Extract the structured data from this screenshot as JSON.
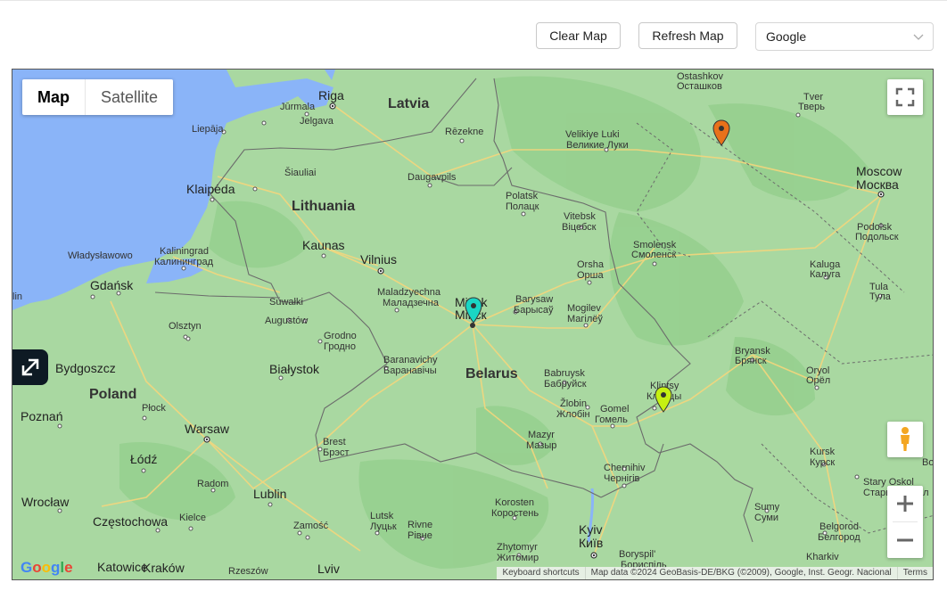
{
  "toolbar": {
    "clear_label": "Clear Map",
    "refresh_label": "Refresh Map",
    "provider_selected": "Google"
  },
  "map": {
    "type_controls": {
      "map_label": "Map",
      "satellite_label": "Satellite",
      "active": "Map"
    },
    "countries": [
      "Latvia",
      "Lithuania",
      "Belarus",
      "Poland"
    ],
    "labels": {
      "riga": "Riga",
      "jurmala": "Jūrmala",
      "jelgava": "Jelgava",
      "liepaja": "Liepāja",
      "rezekne": "Rēzekne",
      "siauliai": "Šiauliai",
      "daugavpils": "Daugavpils",
      "klaipeda": "Klaipėda",
      "kaunas": "Kaunas",
      "vilnius": "Vilnius",
      "kaliningrad": "Kaliningrad",
      "kaliningrad_ru": "Калининград",
      "wladyslawowo": "Władysławowo",
      "gdansk": "Gdańsk",
      "suwalki": "Suwałki",
      "augustow": "Augustów",
      "olsztyn": "Olsztyn",
      "bydgoszcz": "Bydgoszcz",
      "bialystok": "Białystok",
      "grodno": "Grodno",
      "grodno_ru": "Гродно",
      "poznan": "Poznań",
      "plock": "Płock",
      "warsaw": "Warsaw",
      "lodz": "Łódź",
      "radom": "Radom",
      "lublin": "Lublin",
      "wroclaw": "Wrocław",
      "czestochowa": "Częstochowa",
      "kielce": "Kielce",
      "katowice": "Katowice",
      "krakow": "Kraków",
      "rzeszow": "Rzeszów",
      "lviv": "Lviv",
      "zamosc": "Zamość",
      "maladzyechna": "Maladzyechna",
      "maladzyechna_ru": "Маладзечна",
      "minsk": "Minsk",
      "minsk_ru": "Мінск",
      "baranavichy": "Baranavichy",
      "baranavichy_ru": "Баранавічы",
      "brest": "Brest",
      "brest_ru": "Брэст",
      "polatsk": "Polatsk",
      "polatsk_ru": "Полацк",
      "vitebsk": "Vitebsk",
      "vitebsk_ru": "Віцебск",
      "orsha": "Orsha",
      "orsha_ru": "Орша",
      "barysaw": "Barysaw",
      "barysaw_ru": "Барысаў",
      "mogilev": "Mogilev",
      "mogilev_ru": "Магілёў",
      "babruysk": "Babruysk",
      "babruysk_ru": "Бабруйск",
      "zlobin": "Žlobin",
      "zlobin_ru": "Жлобін",
      "gomel": "Gomel",
      "gomel_ru": "Гомель",
      "mazyr": "Mazyr",
      "mazyr_ru": "Мазыр",
      "velikie_luki": "Velikiye Luki",
      "velikie_luki_ru": "Великие Луки",
      "ostashkov": "Ostashkov",
      "ostashkov_ru": "Осташков",
      "tver": "Tver",
      "tver_ru": "Тверь",
      "moscow": "Moscow",
      "moscow_ru": "Москва",
      "podolsk": "Podolsk",
      "podolsk_ru": "Подольск",
      "smolensk": "Smolensk",
      "smolensk_ru": "Смоленск",
      "kaluga": "Kaluga",
      "kaluga_ru": "Калуга",
      "tula": "Tula",
      "tula_ru": "Тула",
      "bryansk": "Bryansk",
      "bryansk_ru": "Брянск",
      "klintsy": "Klintsy",
      "klintsy_ru": "Клинцы",
      "oryol": "Oryol",
      "oryol_ru": "Орёл",
      "kursk": "Kursk",
      "kursk_ru": "Курск",
      "stary_oskol": "Stary Oskol",
      "stary_oskol_ru": "Старый Оскол",
      "sumy": "Sumy",
      "sumy_ru": "Суми",
      "belgorod": "Belgorod",
      "belgorod_ru": "Белгород",
      "kharkiv": "Kharkiv",
      "chernihiv": "Chernihiv",
      "chernihiv_ru": "Чернігів",
      "korosten": "Korosten",
      "korosten_ru": "Коростень",
      "lutsk": "Lutsk",
      "lutsk_ru": "Луцьк",
      "rivne": "Rivne",
      "rivne_ru": "Рівне",
      "zhytomyr": "Zhytomyr",
      "zhytomyr_ru": "Житомир",
      "kyiv": "Kyiv",
      "kyiv_ru": "Київ",
      "boryspil": "Boryspil'",
      "boryspil_ru": "Бориспіль",
      "edge_lin": "lin",
      "edge_bo": "Bo"
    },
    "markers": [
      {
        "name": "marker-orange",
        "color": "#e8711a",
        "near": "Velikiye Luki – Tver"
      },
      {
        "name": "marker-teal",
        "color": "#1ad6c4",
        "near": "Minsk"
      },
      {
        "name": "marker-yellow",
        "color": "#c6f012",
        "near": "Klintsy"
      }
    ],
    "footer": {
      "shortcuts": "Keyboard shortcuts",
      "attribution": "Map data ©2024 GeoBasis-DE/BKG (©2009), Google, Inst. Geogr. Nacional",
      "terms": "Terms"
    },
    "logo_text": "Google",
    "colors": {
      "land": "#a9d8a1",
      "water": "#8ab4f8",
      "dark_green": "#8fcc88",
      "border": "#6b6b6b",
      "roads": "#f7d07a"
    }
  }
}
